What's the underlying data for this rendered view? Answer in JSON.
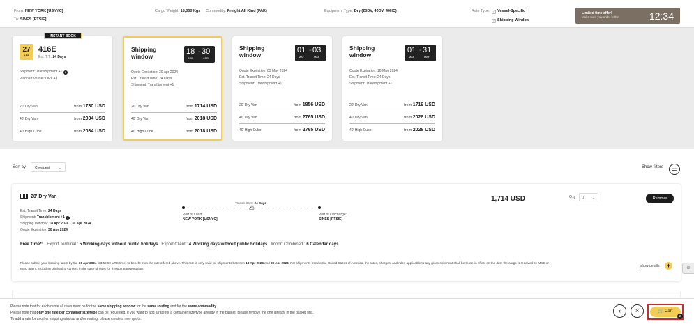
{
  "header": {
    "from_label": "From:",
    "from_value": "NEW YORK [USNYC]",
    "to_label": "To:",
    "to_value": "SINES [PTSIE]",
    "weight_label": "Cargo Weight:",
    "weight_value": "18,000 Kgs",
    "commodity_label": "Commodity:",
    "commodity_value": "Freight All Kind (FAK)",
    "equipment_label": "Equipment Type:",
    "equipment_value": "Dry (20DV, 40DV, 40HC)",
    "rate_type_label": "Rate Type:",
    "rate_type_options": [
      "Vessel-Specific",
      "Shipping Window"
    ],
    "offer_title": "Limited time offer!",
    "offer_sub": "Make sure you order within",
    "timer": "12:34"
  },
  "cards": [
    {
      "badge": "INSTANT BOOK",
      "date_day": "27",
      "date_month": "APR",
      "vessel": "416E",
      "transit_label": "Est. T.T.:",
      "transit_value": "24 Days",
      "shipment": "Shipment: Transhipment +1",
      "planned_vessel": "Planned Vessel: ORCA I",
      "rates": [
        {
          "name": "20' Dry Van",
          "from": "from",
          "price": "1730 USD"
        },
        {
          "name": "40' Dry Van",
          "from": "from",
          "price": "2034 USD"
        },
        {
          "name": "40' High Cube",
          "from": "from",
          "price": "2034 USD"
        }
      ]
    },
    {
      "title_l1": "Shipping",
      "title_l2": "window",
      "range_start": "18",
      "range_end": "30",
      "month_start": "APR",
      "month_end": "APR",
      "quote_exp": "Quote Expiration: 30 Apr 2024",
      "transit": "Est. Transit Time: 24 Days",
      "shipment": "Shipment: Transhipment +1",
      "rates": [
        {
          "name": "20' Dry Van",
          "from": "from",
          "price": "1714 USD"
        },
        {
          "name": "40' Dry Van",
          "from": "from",
          "price": "2018 USD"
        },
        {
          "name": "40' High Cube",
          "from": "from",
          "price": "2018 USD"
        }
      ]
    },
    {
      "title_l1": "Shipping",
      "title_l2": "window",
      "range_start": "01",
      "range_end": "03",
      "month_start": "MAY",
      "month_end": "MAY",
      "quote_exp": "Quote Expiration: 03 May 2024",
      "transit": "Est. Transit Time: 24 Days",
      "shipment": "Shipment: Transhipment +1",
      "rates": [
        {
          "name": "20' Dry Van",
          "from": "from",
          "price": "1856 USD"
        },
        {
          "name": "40' Dry Van",
          "from": "from",
          "price": "2765 USD"
        },
        {
          "name": "40' High Cube",
          "from": "from",
          "price": "2765 USD"
        }
      ]
    },
    {
      "title_l1": "Shipping",
      "title_l2": "window",
      "range_start": "01",
      "range_end": "31",
      "month_start": "MAY",
      "month_end": "MAY",
      "quote_exp": "Quote Expiration: 18 May 2024",
      "transit": "Est. Transit Time: 24 Days",
      "shipment": "Shipment: Transhipment +1",
      "rates": [
        {
          "name": "20' Dry Van",
          "from": "from",
          "price": "1719 USD"
        },
        {
          "name": "40' Dry Van",
          "from": "from",
          "price": "2028 USD"
        },
        {
          "name": "40' High Cube",
          "from": "from",
          "price": "2028 USD"
        }
      ]
    }
  ],
  "sort": {
    "label": "Sort by",
    "value": "Cheapest",
    "filters_label": "Show filters"
  },
  "result": {
    "container": "20' Dry Van",
    "transit_label": "Est. Transit Time:",
    "transit_value": "24 Days",
    "shipment_label": "Shipment:",
    "shipment_value": "Transhipment +1",
    "window_label": "Shipping Window:",
    "window_value": "18 Apr 2024 - 30 Apr 2024",
    "quote_label": "Quote Expiration:",
    "quote_value": "30 Apr 2024",
    "route_tt_label": "Transit Days:",
    "route_tt_value": "24 Days",
    "pol_label": "Port of Load:",
    "pol_value": "NEW YORK [USNYC]",
    "pod_label": "Port of Discharge:",
    "pod_value": "SINES [PTSIE]",
    "price": "1,714 USD",
    "qty_label": "Q.ty",
    "qty_value": "1",
    "remove_label": "Remove",
    "free_time_label": "Free Time*:",
    "free_1_label": "Export Terminal :",
    "free_1_value": "5 Working days without public holidays",
    "free_2_label": "Export Client :",
    "free_2_value": "4 Working days without public holidays",
    "free_3_label": "Import Combined :",
    "free_3_value": "6 Calendar days",
    "fine_1": "Please submit your booking latest by the",
    "fine_2": "30 Apr 2024",
    "fine_3": "(23:59:59 UTC time) to benefit from the rate offered above. This rate is only valid for shipments between",
    "fine_4": "18 Apr 2024",
    "fine_5": "and",
    "fine_6": "30 Apr 2024",
    "fine_7": ". For shipments from/to the United States of America, the rates, charges, and rules applicable to any given shipment shall be those in effect on the date the cargo is received by MSC or MSC agent, including originating carriers in the case of rates for through transportation.",
    "show_details": "show details"
  },
  "footer": {
    "l1a": "Please note that for each quote all rates must be for the",
    "l1b": "same shipping window",
    "l1c": "for the",
    "l1d": "same routing",
    "l1e": "and for the",
    "l1f": "same commodity.",
    "l2a": "Please note that",
    "l2b": "only one rate per container size/type",
    "l2c": "can be requested. If you want to add a rate for a container size/type already in the basket, please remove the one already in the basket first.",
    "l3": "To add a rate for another shipping window and/or routing, please create a new quote.",
    "cart_label": "Cart",
    "cart_count": "2"
  }
}
